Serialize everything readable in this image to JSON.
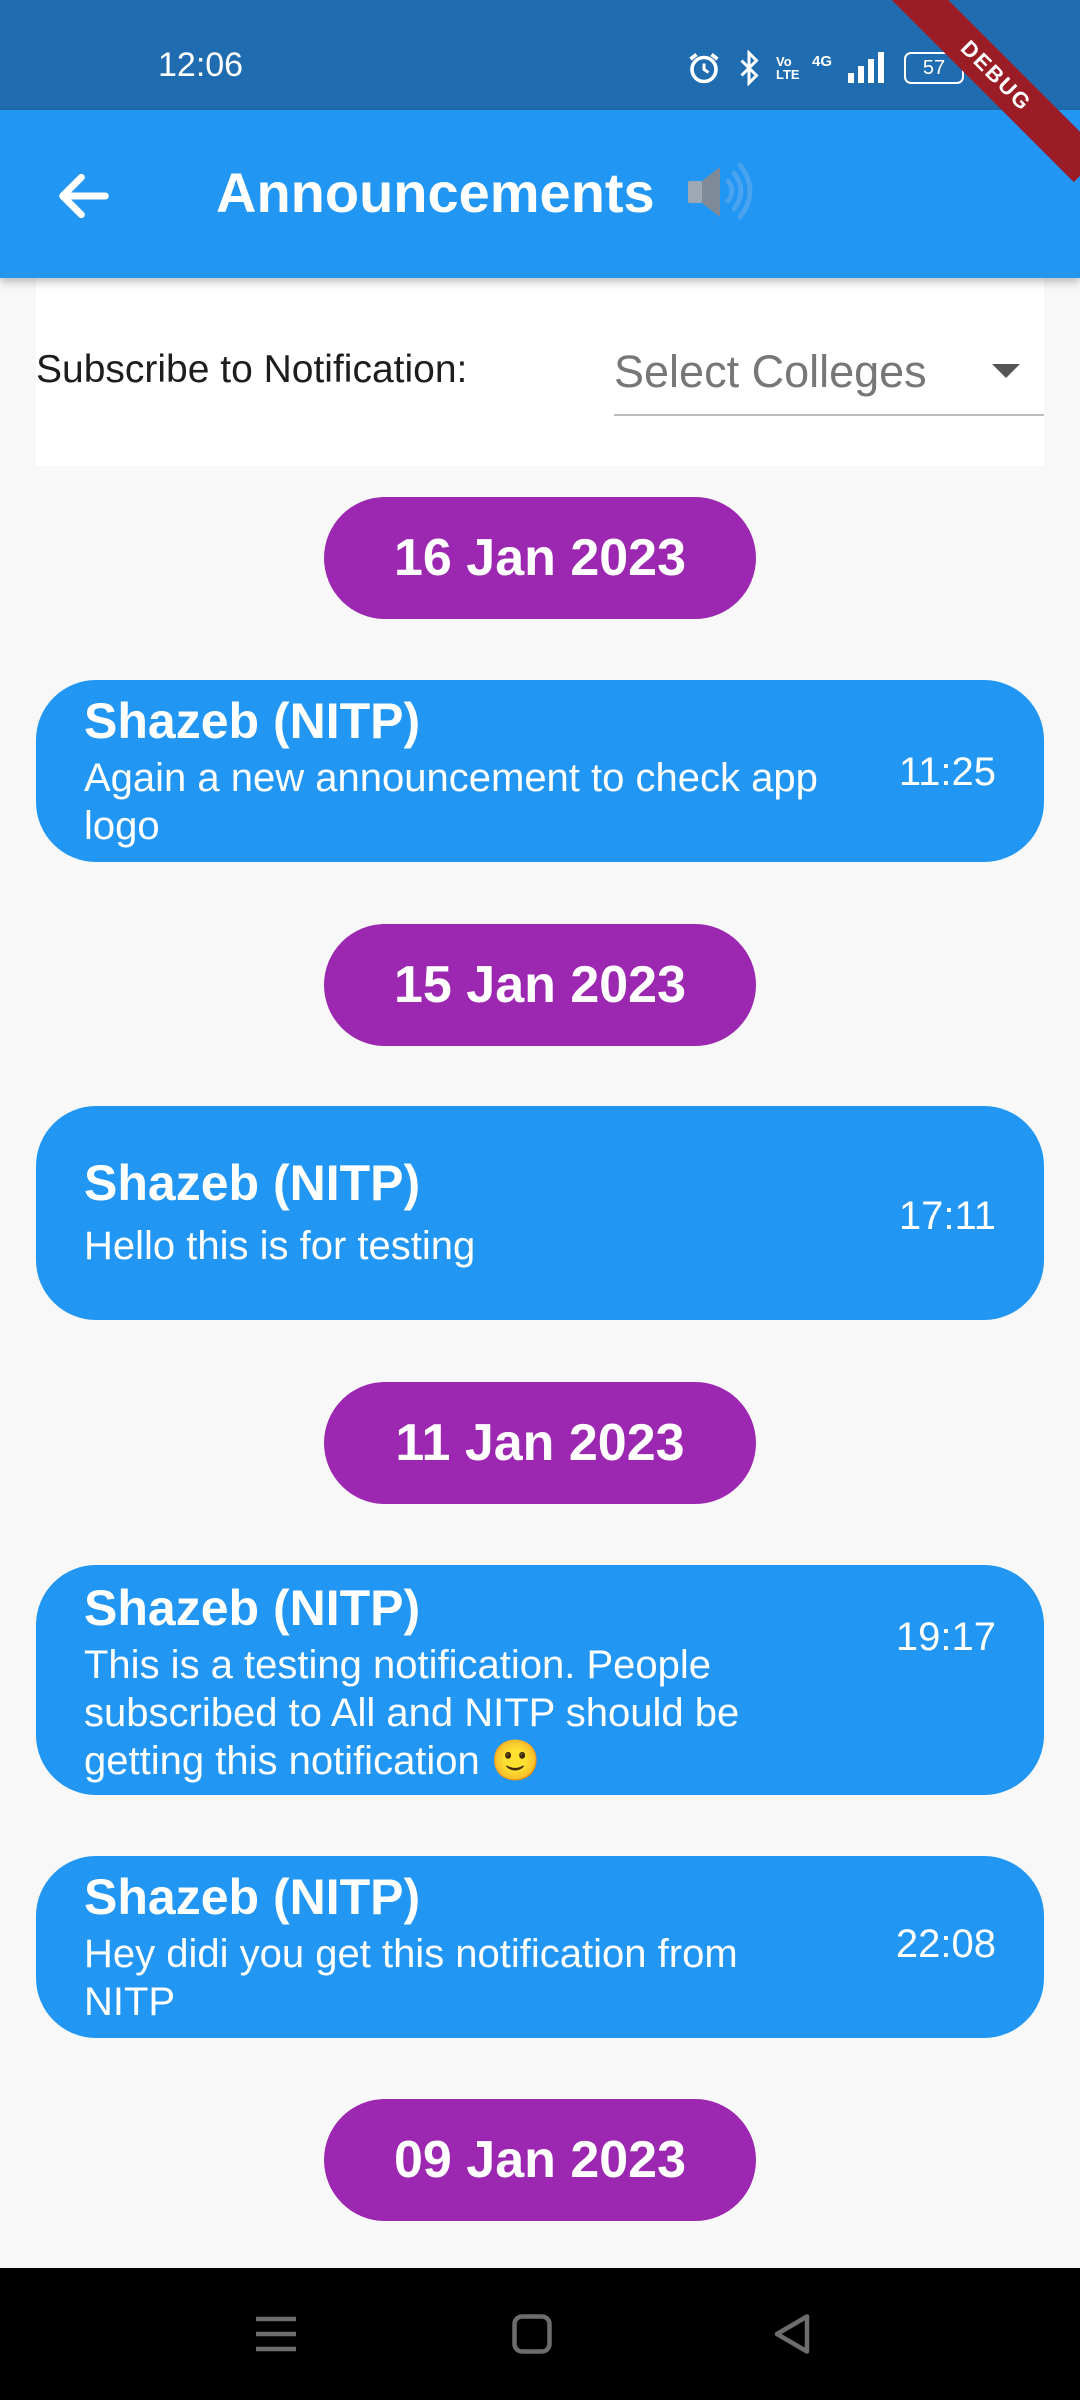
{
  "status_bar": {
    "time": "12:06",
    "network_labels": [
      "Vo LTE",
      "4G"
    ],
    "battery": "57",
    "debug": "DEBUG"
  },
  "app_bar": {
    "title": "Announcements",
    "title_icon": "speaker-icon",
    "back_icon": "back-arrow-icon",
    "color": "#2196f3"
  },
  "subscribe": {
    "label": "Subscribe to Notification:",
    "select_placeholder": "Select Colleges"
  },
  "feed": [
    {
      "type": "date",
      "label": "16 Jan 2023"
    },
    {
      "type": "message",
      "sender": "Shazeb (NITP)",
      "text": "Again a new announcement to check app logo",
      "time": "11:25"
    },
    {
      "type": "date",
      "label": "15 Jan 2023"
    },
    {
      "type": "message",
      "sender": "Shazeb (NITP)",
      "text": "Hello this is for testing",
      "time": "17:11"
    },
    {
      "type": "date",
      "label": "11 Jan 2023"
    },
    {
      "type": "message",
      "sender": "Shazeb (NITP)",
      "text": "This is a testing notification. People subscribed to All and NITP should be getting this notification 🙂",
      "time": "19:17"
    },
    {
      "type": "message",
      "sender": "Shazeb (NITP)",
      "text": "Hey didi you get this notification from NITP",
      "time": "22:08"
    },
    {
      "type": "date",
      "label": "09 Jan 2023"
    }
  ],
  "colors": {
    "date_pill": "#9c27b0",
    "message_card": "#2196f3",
    "status_bar": "#1f6cb0"
  },
  "nav_bar": {
    "icons": [
      "menu-icon",
      "home-square-icon",
      "back-triangle-icon"
    ]
  }
}
